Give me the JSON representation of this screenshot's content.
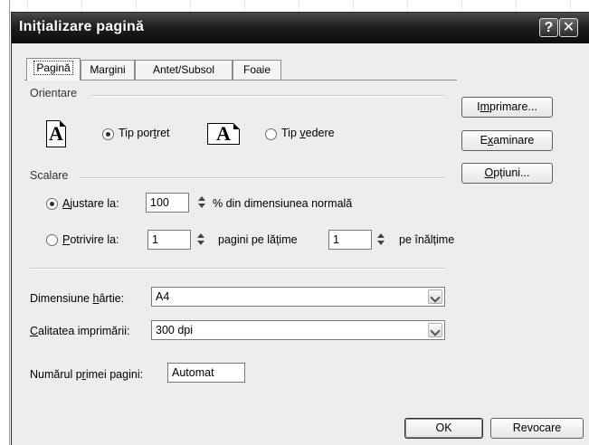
{
  "dialog": {
    "title": "Inițializare pagină",
    "help_glyph": "?",
    "close_glyph": "✕"
  },
  "tabs": [
    {
      "label": "Pagină",
      "active": true
    },
    {
      "label": "Margini",
      "active": false
    },
    {
      "label": "Antet/Subsol",
      "active": false
    },
    {
      "label": "Foaie",
      "active": false
    }
  ],
  "orientation": {
    "group_label": "Orientare",
    "portrait": {
      "label_pre": "Tip por",
      "label_ul": "t",
      "label_post": "ret",
      "checked": true
    },
    "landscape": {
      "label_pre": "Tip ",
      "label_ul": "v",
      "label_post": "edere",
      "checked": false
    },
    "icon_glyph": "A"
  },
  "scaling": {
    "group_label": "Scalare",
    "adjust": {
      "label_ul": "A",
      "label_post": "justare la:",
      "value": "100",
      "suffix": "% din dimensiunea normală",
      "checked": true
    },
    "fit": {
      "label_ul": "P",
      "label_post": "otrivire la:",
      "wide_value": "1",
      "wide_label": "pagini pe lățime",
      "tall_value": "1",
      "tall_label": "pe înălțime",
      "checked": false
    }
  },
  "paper_size": {
    "label_pre": "Dimensiune ",
    "label_ul": "h",
    "label_post": "ârtie:",
    "value": "A4"
  },
  "print_quality": {
    "label_ul": "C",
    "label_post": "alitatea imprimării:",
    "value": "300 dpi"
  },
  "first_page": {
    "label_pre": "Numărul p",
    "label_ul": "r",
    "label_post": "imei pagini:",
    "value": "Automat"
  },
  "side_buttons": {
    "print": {
      "pre": "I",
      "ul": "m",
      "post": "primare..."
    },
    "preview": {
      "pre": "E",
      "ul": "x",
      "post": "aminare"
    },
    "options": {
      "pre": "",
      "ul": "O",
      "post": "pțiuni..."
    }
  },
  "footer": {
    "ok": "OK",
    "cancel": "Revocare"
  },
  "colors": {
    "titlebar": "#0d0d0d",
    "dialog_bg": "#ededed"
  }
}
